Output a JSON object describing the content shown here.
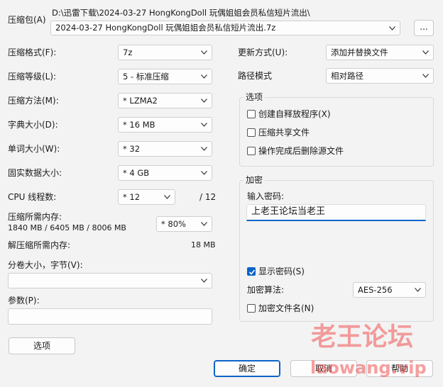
{
  "archive": {
    "label": "压缩包(A)",
    "path": "D:\\迅雷下载\\2024-03-27 HongKongDoll 玩偶姐姐会员私信短片流出\\",
    "filename": "2024-03-27 HongKongDoll 玩偶姐姐会员私信短片流出.7z",
    "browse_label": "..."
  },
  "left": {
    "format": {
      "label": "压缩格式(F):",
      "value": "7z"
    },
    "level": {
      "label": "压缩等级(L):",
      "value": "5 - 标准压缩"
    },
    "method": {
      "label": "压缩方法(M):",
      "value": "*  LZMA2"
    },
    "dict": {
      "label": "字典大小(D):",
      "value": "*  16 MB"
    },
    "word": {
      "label": "单词大小(W):",
      "value": "*  32"
    },
    "solid": {
      "label": "固实数据大小:",
      "value": "*  4 GB"
    },
    "threads": {
      "label": "CPU 线程数:",
      "value": "*  12",
      "max": "/ 12"
    },
    "mem_compress": {
      "label": "压缩所需内存:",
      "value": "1840 MB / 6405 MB / 8006 MB",
      "percent": "* 80%"
    },
    "mem_decompress": {
      "label": "解压缩所需内存:",
      "value": "18 MB"
    },
    "split": {
      "label": "分卷大小，字节(V):",
      "value": ""
    },
    "params": {
      "label": "参数(P):",
      "value": ""
    },
    "options_button": "选项"
  },
  "right": {
    "update": {
      "label": "更新方式(U):",
      "value": "添加并替换文件"
    },
    "pathmode": {
      "label": "路径模式",
      "value": "相对路径"
    },
    "options": {
      "title": "选项",
      "sfx": {
        "label": "创建自释放程序(X)",
        "checked": false
      },
      "shared": {
        "label": "压缩共享文件",
        "checked": false
      },
      "delete": {
        "label": "操作完成后删除源文件",
        "checked": false
      }
    },
    "encryption": {
      "title": "加密",
      "pwd_label": "输入密码:",
      "pwd_value": "上老王论坛当老王",
      "show_pwd": {
        "label": "显示密码(S)",
        "checked": true
      },
      "algo_label": "加密算法:",
      "algo_value": "AES-256",
      "enc_names": {
        "label": "加密文件名(N)",
        "checked": false
      }
    }
  },
  "buttons": {
    "ok": "确定",
    "cancel": "取消",
    "help": "帮助"
  },
  "watermark": {
    "text1": "老王论坛",
    "text2": "laowang.vip"
  },
  "colors": {
    "accent": "#0a64c8",
    "watermark": "#f05050"
  }
}
